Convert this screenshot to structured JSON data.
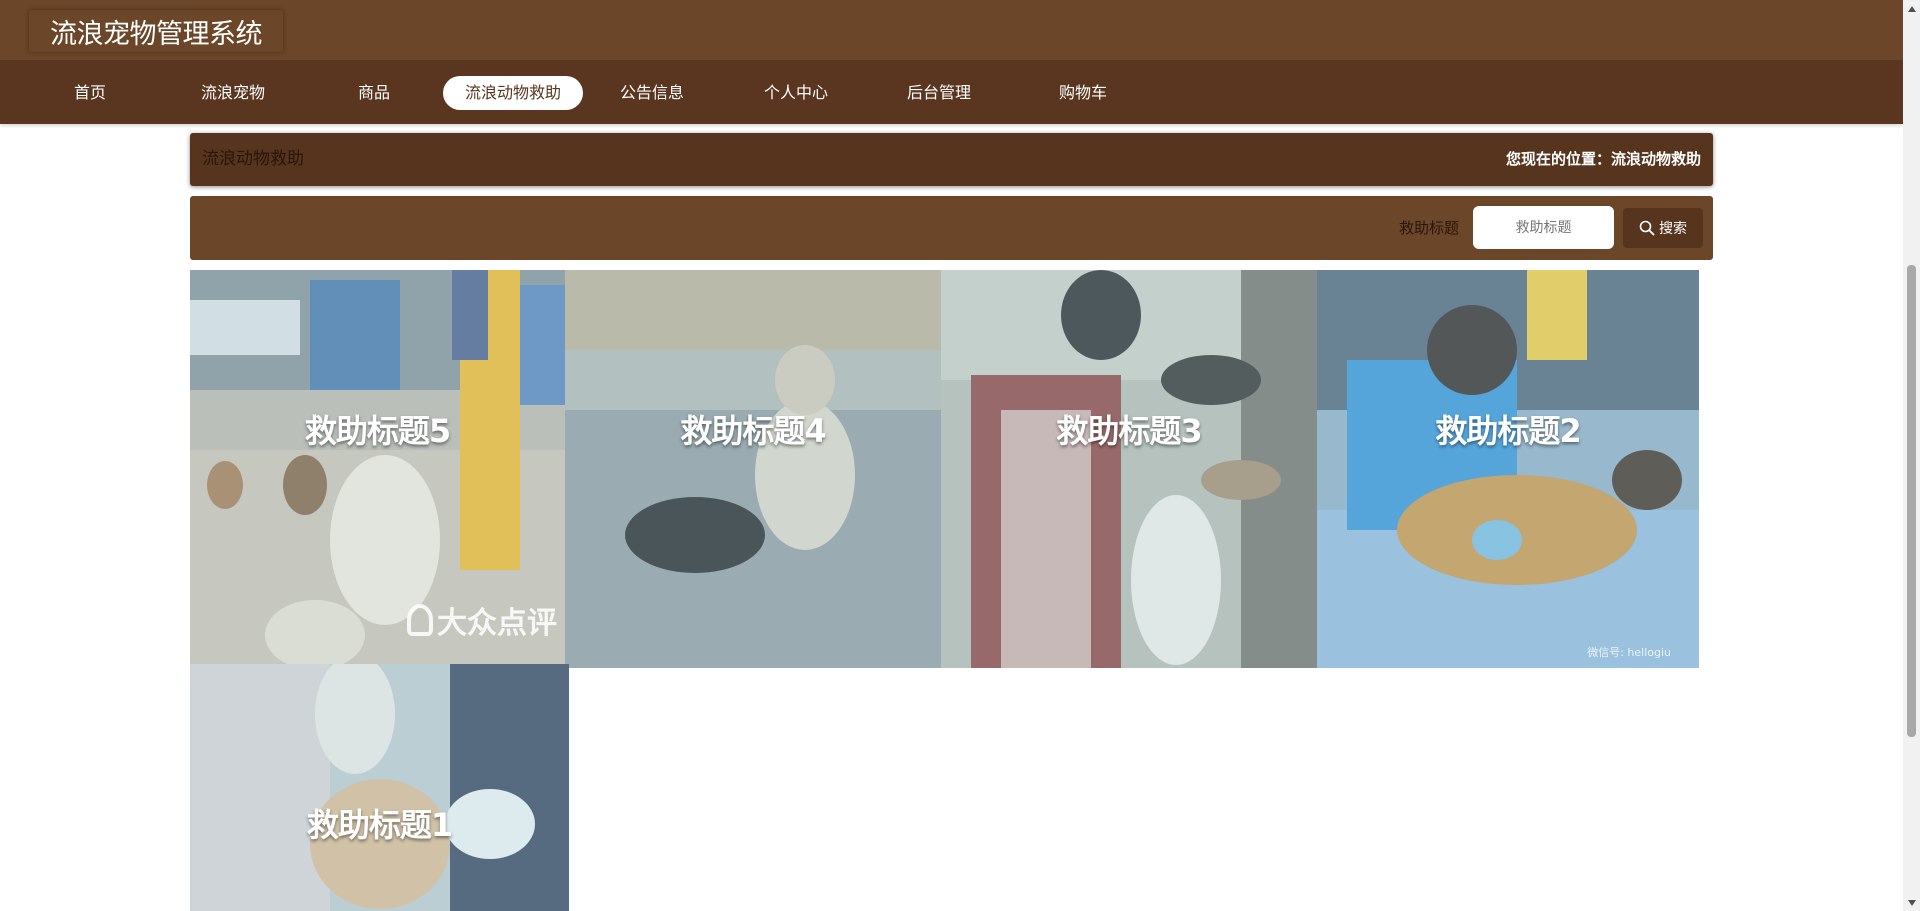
{
  "app": {
    "title": "流浪宠物管理系统"
  },
  "nav": {
    "items": [
      {
        "label": "首页"
      },
      {
        "label": "流浪宠物"
      },
      {
        "label": "商品"
      },
      {
        "label": "流浪动物救助",
        "active": true
      },
      {
        "label": "公告信息"
      },
      {
        "label": "个人中心"
      },
      {
        "label": "后台管理"
      },
      {
        "label": "购物车"
      }
    ]
  },
  "page": {
    "title": "流浪动物救助",
    "breadcrumb": "您现在的位置：流浪动物救助"
  },
  "search": {
    "label": "救助标题",
    "placeholder": "救助标题",
    "value": "",
    "button_label": "搜索",
    "button_icon": "search-icon"
  },
  "cards": [
    {
      "title": "救助标题5",
      "watermark": "大众点评"
    },
    {
      "title": "救助标题4"
    },
    {
      "title": "救助标题3"
    },
    {
      "title": "救助标题2",
      "watermark": "微信号: hellogiu"
    },
    {
      "title": "救助标题1"
    }
  ],
  "colors": {
    "header": "#6b4628",
    "nav": "#5a3620",
    "page_head": "#56341e",
    "active_tab_bg": "#ffffff"
  }
}
